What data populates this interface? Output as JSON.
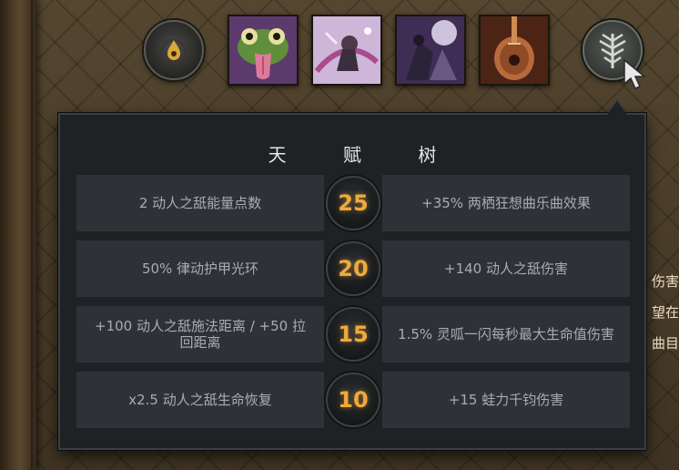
{
  "talent_tree": {
    "title": "天 赋 树",
    "rows": [
      {
        "level": "25",
        "left": "2 动人之舐能量点数",
        "right": "+35% 两栖狂想曲乐曲效果"
      },
      {
        "level": "20",
        "left": "50% 律动护甲光环",
        "right": "+140 动人之舐伤害"
      },
      {
        "level": "15",
        "left": "+100 动人之舐施法距离 / +50 拉回距离",
        "right": "1.5% 灵呱一闪每秒最大生命值伤害"
      },
      {
        "level": "10",
        "left": "x2.5 动人之舐生命恢复",
        "right": "+15 蛙力千钧伤害"
      }
    ]
  },
  "side_text": [
    "伤害",
    "望在",
    "曲目"
  ],
  "icons": {
    "neutral_slot": "droplet-icon",
    "talent_button": "talent-tree-icon",
    "cursor": "mouse-cursor-icon",
    "items": [
      "frog-tongue-icon",
      "dancing-ability-icon",
      "shadow-spirit-icon",
      "lute-instrument-icon"
    ]
  },
  "colors": {
    "level_text": "#f0a93b",
    "panel_bg": "#1f2224",
    "row_bg": "#2e3236",
    "row_text": "#a9adb1"
  }
}
